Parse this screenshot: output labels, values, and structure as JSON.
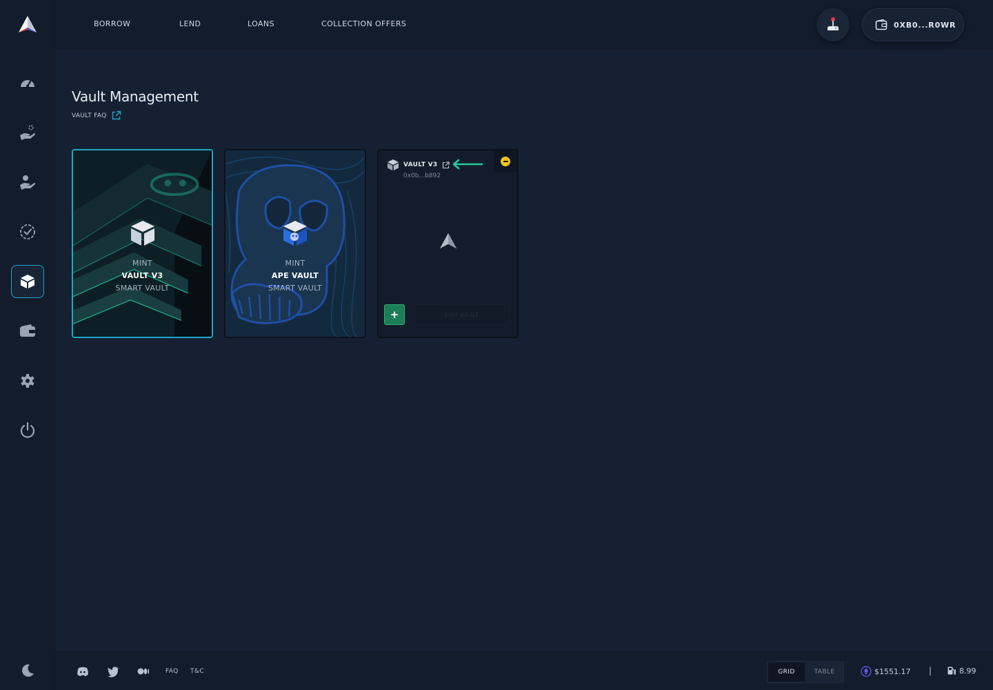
{
  "nav": {
    "items": [
      "BORROW",
      "LEND",
      "LOANS",
      "COLLECTION OFFERS"
    ],
    "wallet_label": "0XB0...R0WR"
  },
  "sidebar": {
    "items": [
      "dashboard-icon",
      "lend-hand-icon",
      "borrow-hand-icon",
      "loans-clock-icon",
      "vault-icon",
      "wallet-icon",
      "gear-icon",
      "power-icon"
    ],
    "active": "vault-icon"
  },
  "page": {
    "title": "Vault Management",
    "faq_label": "VAULT FAQ"
  },
  "cards": {
    "mint_v3": {
      "line1": "MINT",
      "line2": "VAULT V3",
      "line3": "SMART VAULT"
    },
    "mint_ape": {
      "line1": "MINT",
      "line2": "APE VAULT",
      "line3": "SMART VAULT"
    },
    "vault": {
      "name": "VAULT V3",
      "address": "0x0b...b892",
      "list_label": "LIST VAULT",
      "add_label": "+"
    }
  },
  "footer": {
    "faq": "FAQ",
    "tos": "T&C",
    "view_grid": "GRID",
    "view_table": "TABLE",
    "active_view": "GRID",
    "eth_price": "$1551.17",
    "separator": "|",
    "gas": "8.99"
  },
  "colors": {
    "accent": "#1fa6c9",
    "background": "#152032",
    "panel": "#131c2b",
    "success": "#1c7d56",
    "warning": "#f2c322",
    "arrow": "#27c9a0"
  }
}
